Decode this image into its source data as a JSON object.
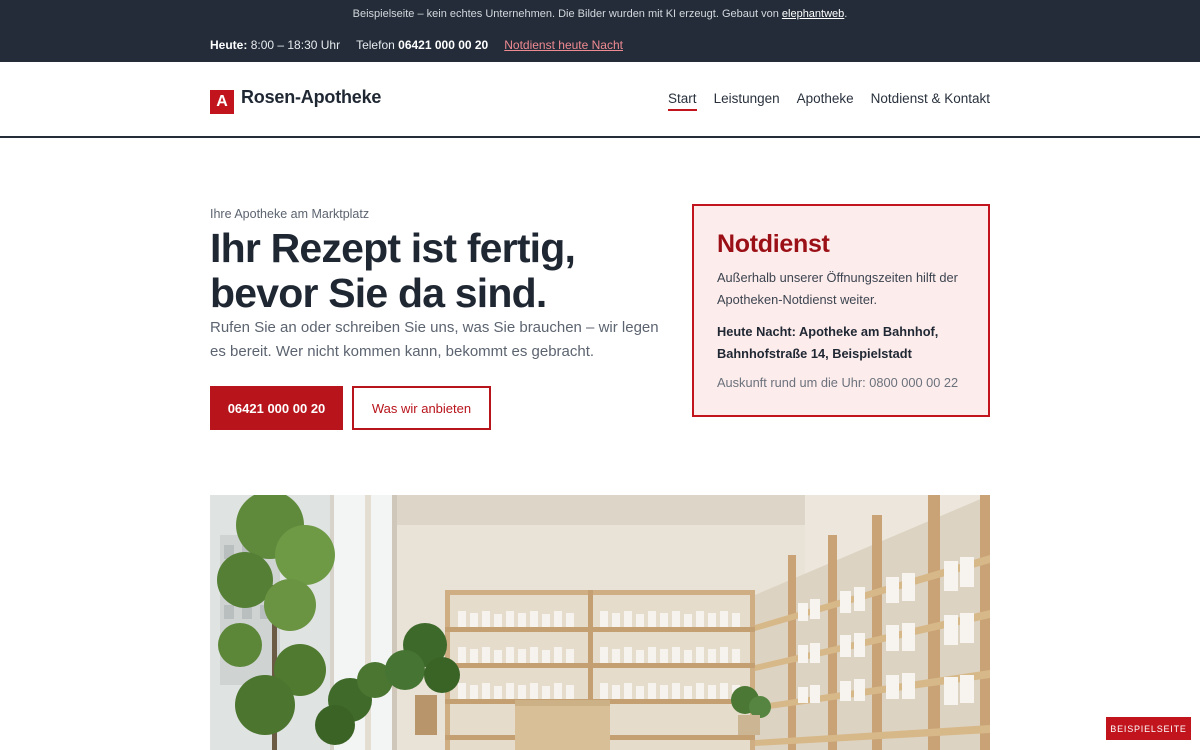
{
  "topbar": {
    "notice_prefix": "Beispielseite – kein echtes Unternehmen. Die Bilder wurden mit KI erzeugt. Gebaut von ",
    "notice_link": "elephantweb",
    "notice_suffix": ".",
    "today_label": "Heute:",
    "today_hours": "8:00 – 18:30 Uhr",
    "phone_label": "Telefon",
    "phone_number": "06421 000 00 20",
    "night_service_link": "Notdienst heute Nacht"
  },
  "header": {
    "logo_letter": "A",
    "brand_name": "Rosen-Apotheke",
    "nav": [
      {
        "label": "Start",
        "active": true
      },
      {
        "label": "Leistungen",
        "active": false
      },
      {
        "label": "Apotheke",
        "active": false
      },
      {
        "label": "Notdienst & Kontakt",
        "active": false
      }
    ]
  },
  "hero": {
    "eyebrow": "Ihre Apotheke am Marktplatz",
    "headline": "Ihr Rezept ist fertig, bevor Sie da sind.",
    "lead": "Rufen Sie an oder schreiben Sie uns, was Sie brauchen – wir legen es bereit. Wer nicht kommen kann, bekommt es gebracht.",
    "primary_button": "06421 000 00 20",
    "secondary_button": "Was wir anbieten"
  },
  "notdienst": {
    "title": "Notdienst",
    "text": "Außerhalb unserer Öffnungszeiten hilft der Apotheken-Notdienst weiter.",
    "tonight": "Heute Nacht: Apotheke am Bahnhof, Bahnhofstraße 14, Beispielstadt",
    "hotline": "Auskunft rund um die Uhr: 0800 000 00 22"
  },
  "corner_badge": "BEISPIELSEITE",
  "colors": {
    "accent": "#c1141c",
    "dark": "#232c38",
    "notdienst_bg": "#fdecec"
  }
}
